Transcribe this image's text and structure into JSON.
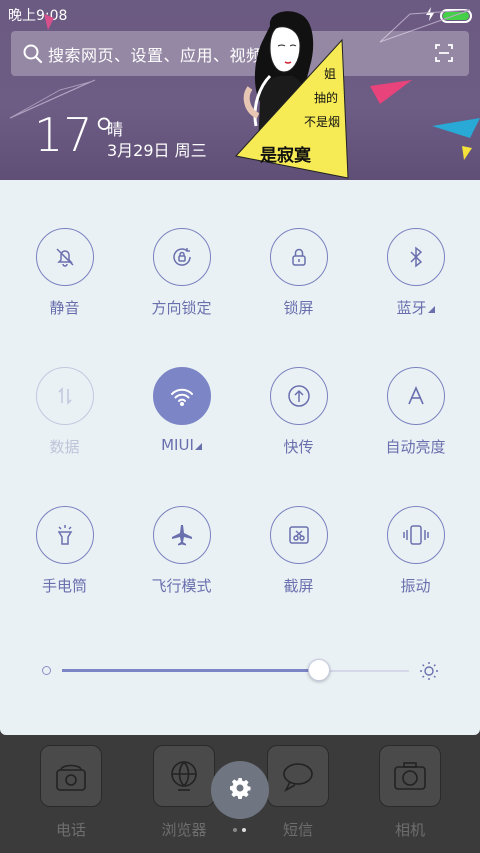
{
  "status_bar": {
    "time": "晚上9:08",
    "battery_level": 1.0,
    "battery_color": "#46d04a"
  },
  "search": {
    "placeholder": "搜索网页、设置、应用、视频..."
  },
  "weather": {
    "temperature": "17°",
    "condition": "晴",
    "date": "3月29日 周三"
  },
  "wallpaper_art": {
    "text_lines": [
      "姐",
      "抽的",
      "不是烟",
      "是寂寞"
    ]
  },
  "toggles": [
    {
      "label": "静音",
      "icon": "bell-off-icon",
      "state": "off"
    },
    {
      "label": "方向锁定",
      "icon": "rotation-lock-icon",
      "state": "off"
    },
    {
      "label": "锁屏",
      "icon": "lock-icon",
      "state": "off"
    },
    {
      "label": "蓝牙",
      "icon": "bluetooth-icon",
      "state": "off",
      "has_more": true
    },
    {
      "label": "数据",
      "icon": "mobile-data-icon",
      "state": "disabled"
    },
    {
      "label": "MIUI",
      "icon": "wifi-icon",
      "state": "on",
      "has_more": true
    },
    {
      "label": "快传",
      "icon": "quick-transfer-icon",
      "state": "off"
    },
    {
      "label": "自动亮度",
      "icon": "auto-brightness-icon",
      "state": "off"
    },
    {
      "label": "手电筒",
      "icon": "flashlight-icon",
      "state": "off"
    },
    {
      "label": "飞行模式",
      "icon": "airplane-icon",
      "state": "off"
    },
    {
      "label": "截屏",
      "icon": "screenshot-icon",
      "state": "off"
    },
    {
      "label": "振动",
      "icon": "vibrate-icon",
      "state": "off"
    }
  ],
  "brightness": {
    "level": 0.74
  },
  "dock": {
    "apps": [
      {
        "label": "电话",
        "icon": "phone-icon"
      },
      {
        "label": "浏览器",
        "icon": "globe-icon"
      },
      {
        "label": "短信",
        "icon": "message-icon"
      },
      {
        "label": "相机",
        "icon": "camera-icon"
      }
    ],
    "settings_icon": "gear-icon",
    "pages": 2,
    "current_page": 2
  },
  "colors": {
    "accent": "#7c85c6",
    "panel_bg": "#eaf1f5",
    "header_bg": "#6b5a82"
  }
}
